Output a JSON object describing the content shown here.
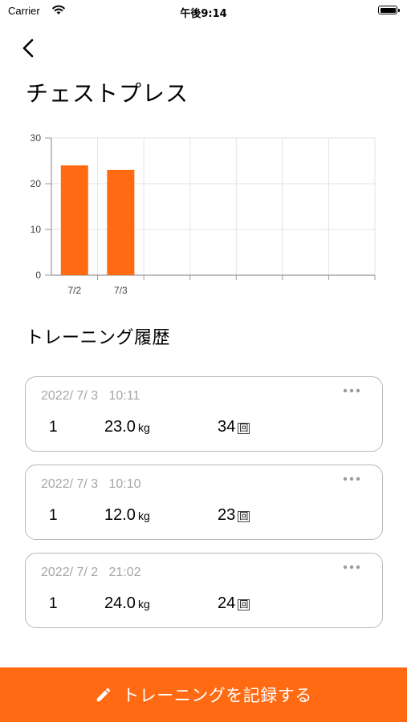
{
  "status_bar": {
    "carrier": "Carrier",
    "time": "午後9:14"
  },
  "header": {
    "title": "チェストプレス"
  },
  "chart_data": {
    "type": "bar",
    "categories": [
      "7/2",
      "7/3"
    ],
    "values": [
      24.0,
      23.0
    ],
    "ylim": [
      0,
      30
    ],
    "yticks": [
      0,
      10,
      20,
      30
    ],
    "title": "",
    "xlabel": "",
    "ylabel": "",
    "grid": true,
    "bar_color": "#ff6a13",
    "total_slots": 7
  },
  "history": {
    "title": "トレーニング履歴",
    "entries": [
      {
        "datetime": "2022/ 7/ 3   10:11",
        "set": "1",
        "weight": "23.0",
        "weight_unit": "kg",
        "reps": "34",
        "reps_unit": "回"
      },
      {
        "datetime": "2022/ 7/ 3   10:10",
        "set": "1",
        "weight": "12.0",
        "weight_unit": "kg",
        "reps": "23",
        "reps_unit": "回"
      },
      {
        "datetime": "2022/ 7/ 2   21:02",
        "set": "1",
        "weight": "24.0",
        "weight_unit": "kg",
        "reps": "24",
        "reps_unit": "回"
      }
    ]
  },
  "footer": {
    "record_label": "トレーニングを記録する",
    "accent": "#ff6a13"
  }
}
